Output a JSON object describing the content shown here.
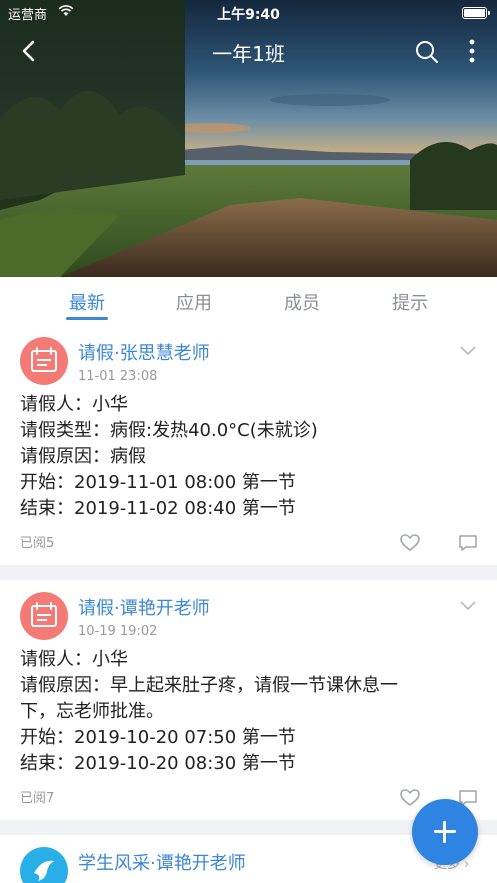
{
  "status_bar": {
    "carrier": "运营商",
    "time": "上午9:40"
  },
  "nav": {
    "title": "一年1班"
  },
  "tabs": [
    {
      "label": "最新",
      "active": true
    },
    {
      "label": "应用",
      "active": false
    },
    {
      "label": "成员",
      "active": false
    },
    {
      "label": "提示",
      "active": false
    }
  ],
  "posts": [
    {
      "title": "请假·张思慧老师",
      "time": "11-01 23:08",
      "lines": [
        "请假人：小华",
        "请假类型：病假:发热40.0°C(未就诊)",
        "请假原因：病假",
        "开始：2019-11-01 08:00 第一节",
        "结束：2019-11-02 08:40 第一节"
      ],
      "read": "已阅5"
    },
    {
      "title": "请假·谭艳开老师",
      "time": "10-19 19:02",
      "lines": [
        "请假人：小华",
        "请假原因：早上起来肚子疼，请假一节课休息一",
        "下，忘老师批准。",
        "开始：2019-10-20 07:50 第一节",
        "结束：2019-10-20 08:30 第一节"
      ],
      "read": "已阅7"
    },
    {
      "title": "学生风采·谭艳开老师",
      "more": "更多"
    }
  ],
  "colors": {
    "accent": "#3b87d8",
    "leave_avatar": "#f47a76",
    "style_avatar": "#2aaee8",
    "fab": "#2f84e2"
  }
}
